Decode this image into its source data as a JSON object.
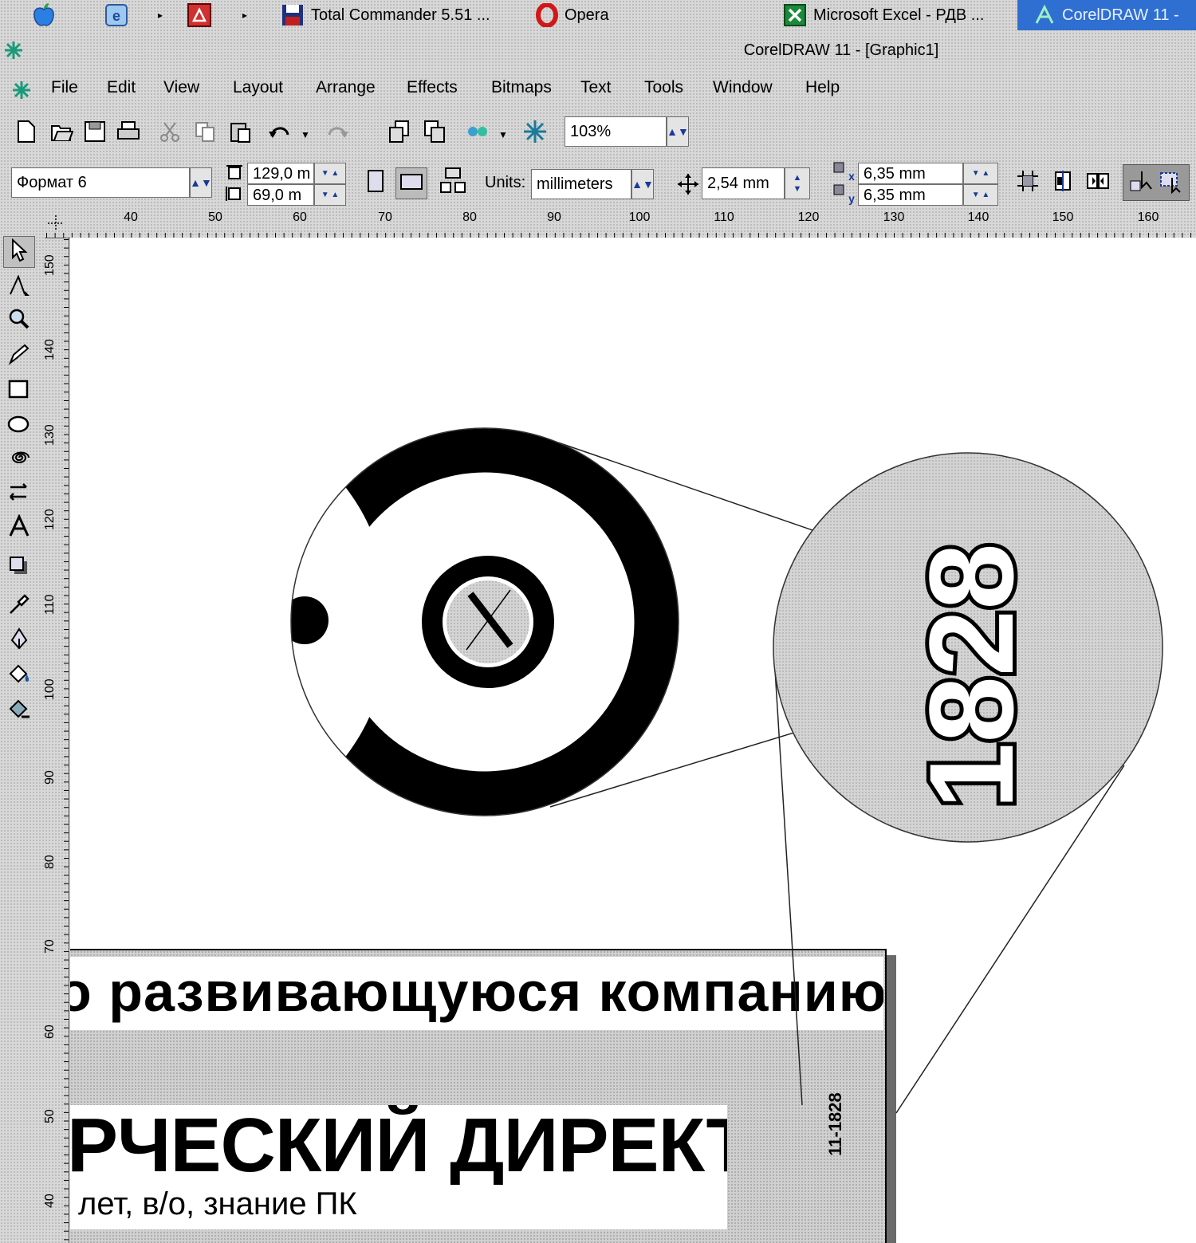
{
  "taskbar": {
    "items": [
      {
        "label": "Total Commander 5.51 ...",
        "icon": "floppy-disk-icon"
      },
      {
        "label": "Opera",
        "icon": "opera-icon"
      },
      {
        "label": "Microsoft Excel - РДВ ...",
        "icon": "excel-icon"
      },
      {
        "label": "CorelDRAW 11 -",
        "icon": "coreldraw-icon",
        "active": true
      }
    ]
  },
  "window": {
    "title": "CorelDRAW 11 - [Graphic1]"
  },
  "menu": [
    "File",
    "Edit",
    "View",
    "Layout",
    "Arrange",
    "Effects",
    "Bitmaps",
    "Text",
    "Tools",
    "Window",
    "Help"
  ],
  "toolbar": {
    "zoom": "103%"
  },
  "property_bar": {
    "paper_type": "Формат 6",
    "width": "129,0 m",
    "height": "69,0 m",
    "units_label": "Units:",
    "units": "millimeters",
    "nudge": "2,54 mm",
    "dup_x": "6,35 mm",
    "dup_y": "6,35 mm"
  },
  "rulers": {
    "horizontal": [
      "40",
      "50",
      "60",
      "70",
      "80",
      "90",
      "100",
      "110",
      "120",
      "130",
      "140",
      "150",
      "160"
    ],
    "vertical": [
      "150",
      "140",
      "130",
      "120",
      "110",
      "100",
      "90",
      "80",
      "70",
      "60",
      "50",
      "40"
    ]
  },
  "document": {
    "line1": "о развивающуюся компанию",
    "line2": "РЧЕСКИЙ ДИРЕКТОР",
    "line3": "лет, в/о, знание ПК",
    "code": "11-1828",
    "zoom_text": "1828"
  },
  "colors": {
    "active_task": "#2f6fd2",
    "page": "#ffffff"
  }
}
